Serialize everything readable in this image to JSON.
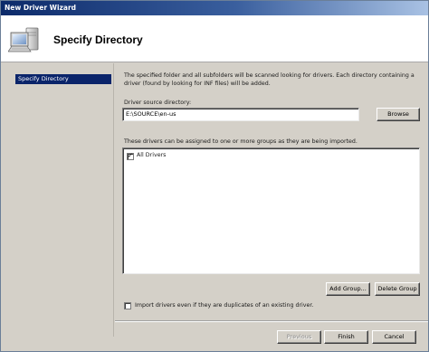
{
  "window": {
    "title": "New Driver Wizard"
  },
  "header": {
    "title": "Specify Directory",
    "icon": "computer-icon"
  },
  "sidebar": {
    "items": [
      {
        "label": "Specify Directory",
        "selected": true
      }
    ]
  },
  "main": {
    "description": "The specified folder and all subfolders will be scanned looking for drivers.  Each directory containing a driver (found by looking for INF files) will be added.",
    "source_label": "Driver source directory:",
    "source_value": "E:\\SOURCE\\en-us",
    "browse_label": "Browse",
    "groups_label": "These drivers can be assigned to one or more groups as they are being imported.",
    "groups": [
      {
        "label": "All Drivers",
        "checked": true
      }
    ],
    "add_group_label": "Add Group...",
    "delete_group_label": "Delete Group",
    "import_duplicates_label": "Import drivers even if they are duplicates of an existing driver.",
    "import_duplicates_checked": false
  },
  "footer": {
    "previous_label": "Previous",
    "finish_label": "Finish",
    "cancel_label": "Cancel"
  },
  "colors": {
    "selection": "#0a246a",
    "dialog_face": "#d4d0c8",
    "title_dark": "#0c2a6a"
  }
}
